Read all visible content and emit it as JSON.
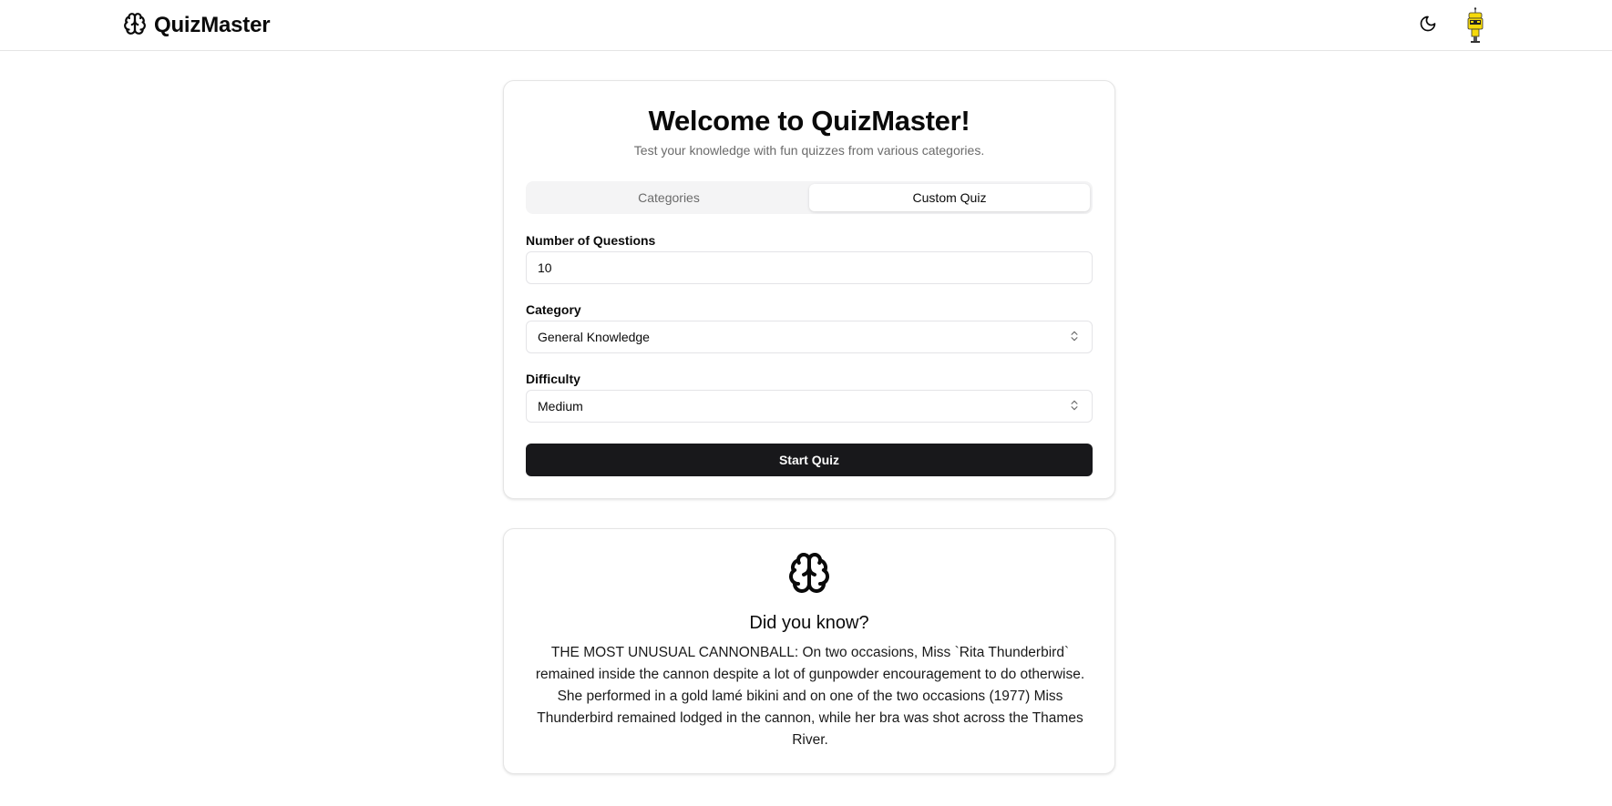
{
  "header": {
    "brand": "QuizMaster",
    "brand_icon": "brain-icon",
    "theme_icon": "moon-icon",
    "avatar_icon": "robot-avatar"
  },
  "quiz_card": {
    "title": "Welcome to QuizMaster!",
    "subtitle": "Test your knowledge with fun quizzes from various categories.",
    "tabs": [
      {
        "label": "Categories",
        "active": false
      },
      {
        "label": "Custom Quiz",
        "active": true
      }
    ],
    "fields": {
      "num_questions": {
        "label": "Number of Questions",
        "value": "10"
      },
      "category": {
        "label": "Category",
        "value": "General Knowledge"
      },
      "difficulty": {
        "label": "Difficulty",
        "value": "Medium"
      }
    },
    "start_label": "Start Quiz"
  },
  "fact_card": {
    "icon": "brain-icon",
    "title": "Did you know?",
    "text": "THE MOST UNUSUAL CANNONBALL: On two occasions, Miss `Rita Thunderbird` remained inside the cannon despite a lot of gunpowder encouragement to do otherwise. She performed in a gold lamé bikini and on one of the two occasions (1977) Miss Thunderbird remained lodged in the cannon, while her bra was shot across the Thames River."
  },
  "colors": {
    "primary_button": "#18181b",
    "border": "#e5e5e5",
    "muted_text": "#6b6b6b",
    "avatar_yellow": "#f5d90a"
  }
}
